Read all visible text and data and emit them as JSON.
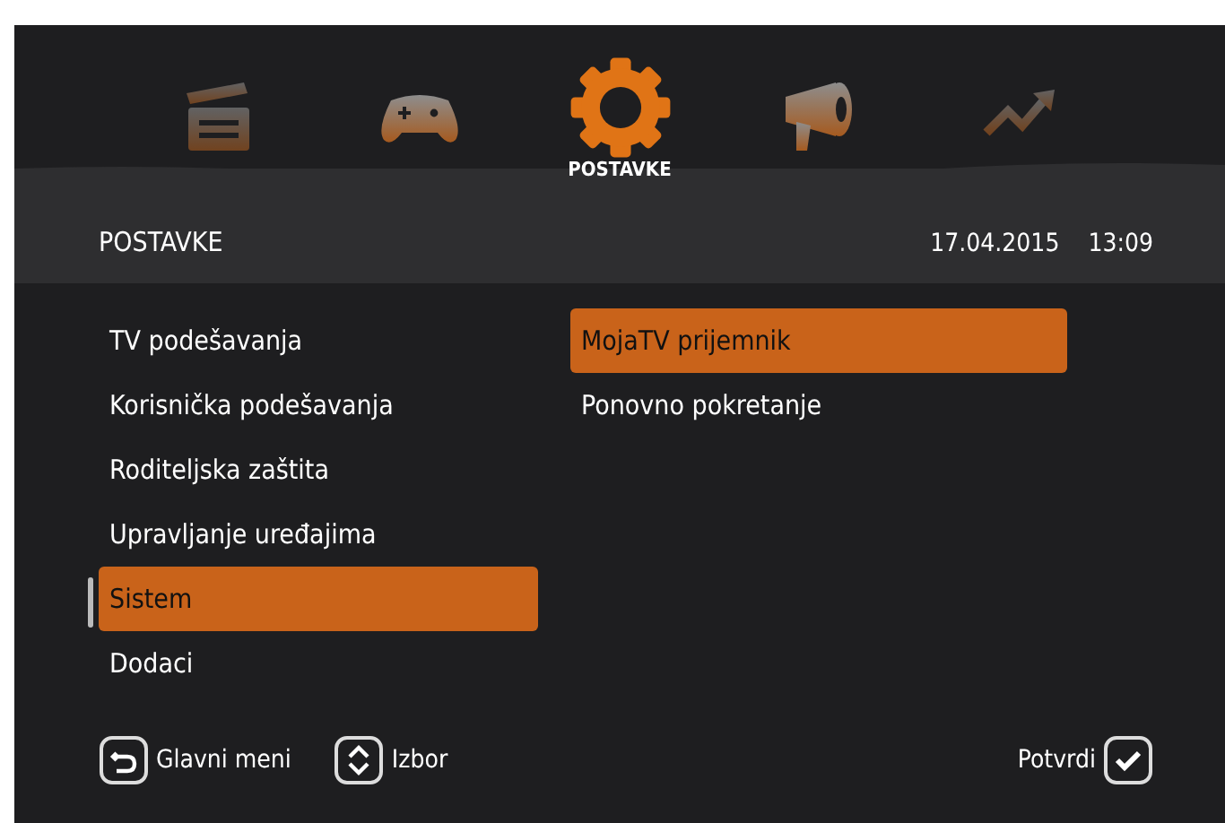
{
  "categories": [
    {
      "kind": "clapperboard",
      "selected": false
    },
    {
      "kind": "gamepad",
      "selected": false
    },
    {
      "kind": "gear",
      "selected": true,
      "label": "POSTAVKE"
    },
    {
      "kind": "megaphone",
      "selected": false
    },
    {
      "kind": "trend",
      "selected": false
    }
  ],
  "header": {
    "title": "POSTAVKE",
    "date": "17.04.2015",
    "time": "13:09"
  },
  "menu": {
    "items": [
      {
        "label": "TV podešavanja",
        "selected": false
      },
      {
        "label": "Korisnička podešavanja",
        "selected": false
      },
      {
        "label": "Roditeljska zaštita",
        "selected": false
      },
      {
        "label": "Upravljanje uređajima",
        "selected": false
      },
      {
        "label": "Sistem",
        "selected": true
      },
      {
        "label": "Dodaci",
        "selected": false
      }
    ]
  },
  "submenu": {
    "items": [
      {
        "label": "MojaTV prijemnik",
        "selected": true
      },
      {
        "label": "Ponovno pokretanje",
        "selected": false
      }
    ]
  },
  "footer": {
    "left_hints": [
      {
        "kind": "back",
        "label": "Glavni meni"
      },
      {
        "kind": "updown",
        "label": "Izbor"
      }
    ],
    "right_hints": [
      {
        "kind": "confirm",
        "label": "Potvrdi"
      }
    ]
  }
}
